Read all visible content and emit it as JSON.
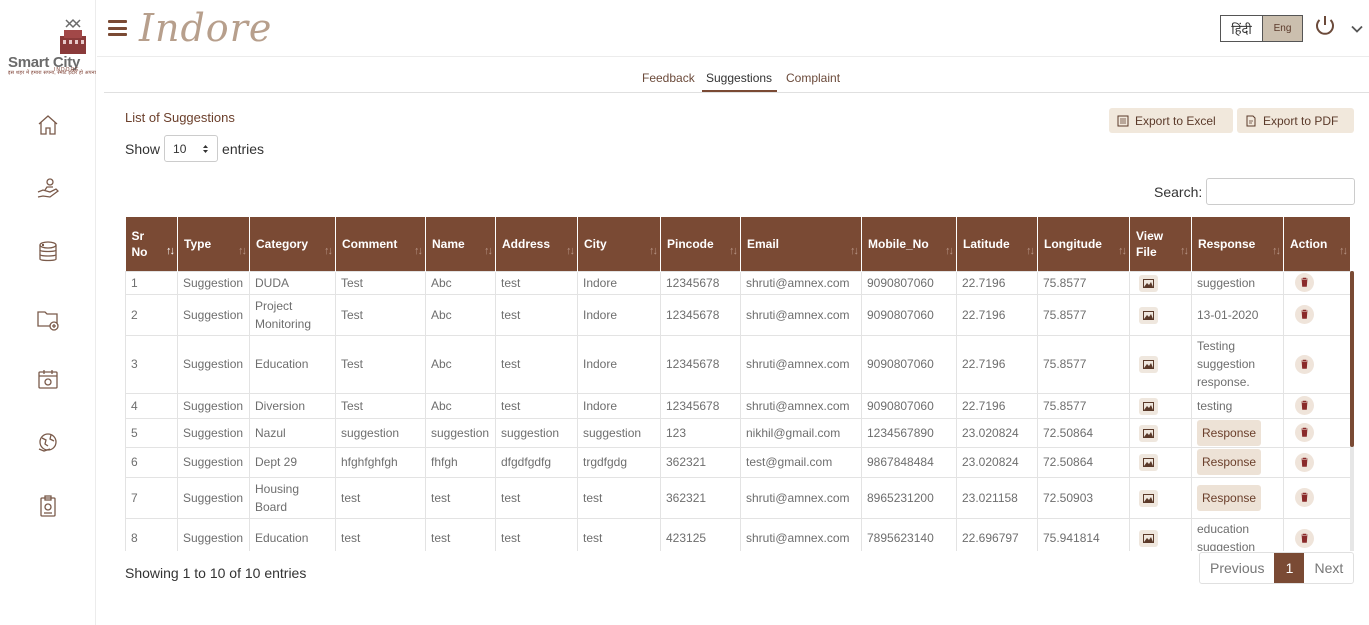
{
  "logo": {
    "name": "Smart City",
    "city": "INDORE",
    "tagline": "इस शहर में हमारा सपना, स्मार्ट इंदौर हो अपना"
  },
  "header": {
    "brand": "Indore",
    "lang_hindi": "हिंदी",
    "lang_english": "Eng"
  },
  "tabs": [
    {
      "label": "Feedback"
    },
    {
      "label": "Suggestions"
    },
    {
      "label": "Complaint"
    }
  ],
  "list": {
    "title": "List of Suggestions",
    "show_label": "Show",
    "entries_value": "10",
    "entries_label": "entries",
    "export_excel": "Export to Excel",
    "export_pdf": "Export to PDF",
    "search_label": "Search:",
    "search_value": ""
  },
  "table": {
    "columns": [
      "Sr No",
      "Type",
      "Category",
      "Comment",
      "Name",
      "Address",
      "City",
      "Pincode",
      "Email",
      "Mobile_No",
      "Latitude",
      "Longitude",
      "View File",
      "Response",
      "Action"
    ],
    "rows": [
      {
        "sr": "1",
        "type": "Suggestion",
        "category": "DUDA",
        "comment": "Test",
        "name": "Abc",
        "address": "test",
        "city": "Indore",
        "pincode": "12345678",
        "email": "shruti@amnex.com",
        "mobile": "9090807060",
        "lat": "22.7196",
        "lng": "75.8577",
        "response": "suggestion"
      },
      {
        "sr": "2",
        "type": "Suggestion",
        "category": "Project Monitoring",
        "comment": "Test",
        "name": "Abc",
        "address": "test",
        "city": "Indore",
        "pincode": "12345678",
        "email": "shruti@amnex.com",
        "mobile": "9090807060",
        "lat": "22.7196",
        "lng": "75.8577",
        "response": "13-01-2020"
      },
      {
        "sr": "3",
        "type": "Suggestion",
        "category": "Education",
        "comment": "Test",
        "name": "Abc",
        "address": "test",
        "city": "Indore",
        "pincode": "12345678",
        "email": "shruti@amnex.com",
        "mobile": "9090807060",
        "lat": "22.7196",
        "lng": "75.8577",
        "response": "Testing suggestion response."
      },
      {
        "sr": "4",
        "type": "Suggestion",
        "category": "Diversion",
        "comment": "Test",
        "name": "Abc",
        "address": "test",
        "city": "Indore",
        "pincode": "12345678",
        "email": "shruti@amnex.com",
        "mobile": "9090807060",
        "lat": "22.7196",
        "lng": "75.8577",
        "response": "testing"
      },
      {
        "sr": "5",
        "type": "Suggestion",
        "category": "Nazul",
        "comment": "suggestion",
        "name": "suggestion",
        "address": "suggestion",
        "city": "suggestion",
        "pincode": "123",
        "email": "nikhil@gmail.com",
        "mobile": "1234567890",
        "lat": "23.020824",
        "lng": "72.50864",
        "response": "Response"
      },
      {
        "sr": "6",
        "type": "Suggestion",
        "category": "Dept 29",
        "comment": "hfghfghfgh",
        "name": "fhfgh",
        "address": "dfgdfgdfg",
        "city": "trgdfgdg",
        "pincode": "362321",
        "email": "test@gmail.com",
        "mobile": "9867848484",
        "lat": "23.020824",
        "lng": "72.50864",
        "response": "Response"
      },
      {
        "sr": "7",
        "type": "Suggestion",
        "category": "Housing Board",
        "comment": "test",
        "name": "test",
        "address": "test",
        "city": "test",
        "pincode": "362321",
        "email": "shruti@amnex.com",
        "mobile": "8965231200",
        "lat": "23.021158",
        "lng": "72.50903",
        "response": "Response"
      },
      {
        "sr": "8",
        "type": "Suggestion",
        "category": "Education",
        "comment": "test",
        "name": "test",
        "address": "test",
        "city": "test",
        "pincode": "423125",
        "email": "shruti@amnex.com",
        "mobile": "7895623140",
        "lat": "22.696797",
        "lng": "75.941814",
        "response": "education suggestion"
      }
    ]
  },
  "footer": {
    "showing": "Showing 1 to 10 of 10 entries",
    "previous": "Previous",
    "page": "1",
    "next": "Next"
  },
  "colors": {
    "primary": "#7a4a34",
    "accent_light": "#f1e8dc"
  }
}
